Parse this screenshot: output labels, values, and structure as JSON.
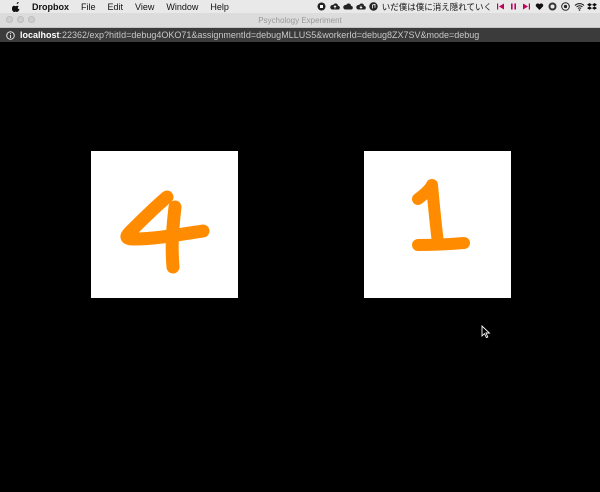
{
  "menubar": {
    "app": "Dropbox",
    "items": [
      "File",
      "Edit",
      "View",
      "Window",
      "Help"
    ],
    "now_playing": "いだ僕は僕に消え隠れていく"
  },
  "window": {
    "title": "Psychology Experiment"
  },
  "address": {
    "host": "localhost",
    "rest": ":22362/exp?hitId=debug4OKO71&assignmentId=debugMLLUS5&workerId=debug8ZX7SV&mode=debug"
  },
  "stimuli": {
    "left_digit": "4",
    "right_digit": "1",
    "stroke_color": "#ff8c00",
    "card_color": "#ffffff",
    "background": "#000000"
  }
}
